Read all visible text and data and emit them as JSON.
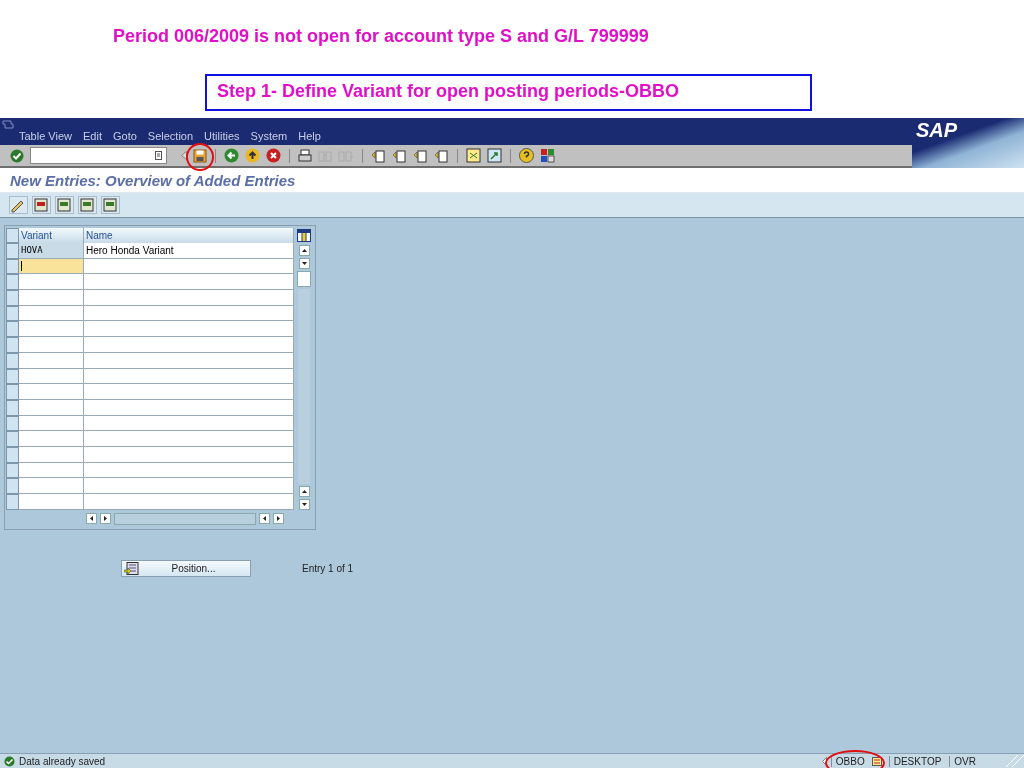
{
  "slide": {
    "heading": "Period 006/2009 is not open for account type S and G/L 799999",
    "step": "Step 1- Define Variant for open posting periods-OBBO"
  },
  "menubar": {
    "items": [
      "Table View",
      "Edit",
      "Goto",
      "Selection",
      "Utilities",
      "System",
      "Help"
    ],
    "logo": "SAP"
  },
  "screen_title": "New Entries: Overview of Added Entries",
  "table": {
    "columns": [
      "Variant",
      "Name"
    ],
    "rows": [
      {
        "variant": "HOVA",
        "name": "Hero Honda Variant",
        "focused": false
      },
      {
        "focused": true
      },
      {
        "focused": false
      },
      {
        "focused": false
      },
      {
        "focused": false
      },
      {
        "focused": false
      },
      {
        "focused": false
      },
      {
        "focused": false
      },
      {
        "focused": false
      },
      {
        "focused": false
      },
      {
        "focused": false
      },
      {
        "focused": false
      },
      {
        "focused": false
      },
      {
        "focused": false
      },
      {
        "focused": false
      },
      {
        "focused": false
      },
      {
        "focused": false
      }
    ]
  },
  "position_button": "Position...",
  "entry_info": "Entry 1 of 1",
  "status_bar": {
    "message": "Data already saved",
    "transaction": "OBBO",
    "system": "DESKTOP",
    "mode": "OVR"
  }
}
